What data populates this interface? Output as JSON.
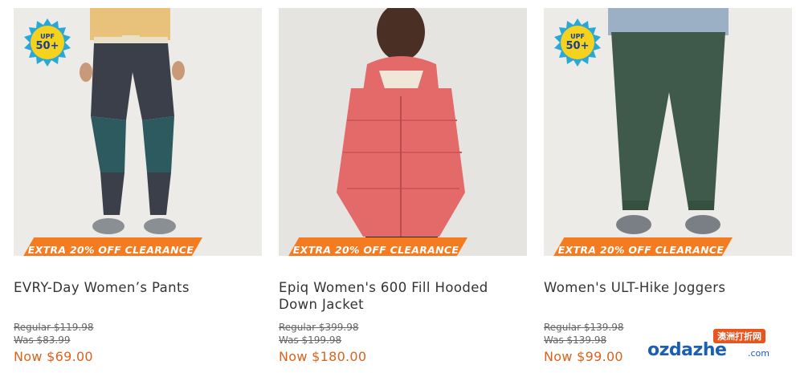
{
  "products": [
    {
      "name": "EVRY-Day Women’s Pants",
      "name_line2": "",
      "badge": "EXTRA 20% OFF CLEARANCE",
      "upf_line1": "UPF",
      "upf_line2": "50+",
      "regular_price": "Regular $119.98",
      "was_price": "Was $83.99",
      "now_price": "Now $69.00"
    },
    {
      "name": "Epiq Women's 600 Fill Hooded",
      "name_line2": "Down Jacket",
      "badge": "EXTRA 20% OFF CLEARANCE",
      "regular_price": "Regular $399.98",
      "was_price": "Was $199.98",
      "now_price": "Now $180.00"
    },
    {
      "name": "Women's ULT-Hike Joggers",
      "name_line2": "",
      "badge": "EXTRA 20% OFF CLEARANCE",
      "upf_line1": "UPF",
      "upf_line2": "50+",
      "regular_price": "Regular $139.98",
      "was_price": "Was $139.98",
      "now_price": "Now $99.00"
    }
  ],
  "watermark": {
    "top_text": "澳洲打折网",
    "main_text": "ozdazhe",
    "suffix": ".com"
  },
  "colors": {
    "badge_orange": "#f47b20",
    "price_now": "#d9631c",
    "upf_yellow": "#f5d21e",
    "upf_blue": "#29a8d8",
    "jacket": "#e46a6a",
    "joggers": "#3f5a4a"
  }
}
